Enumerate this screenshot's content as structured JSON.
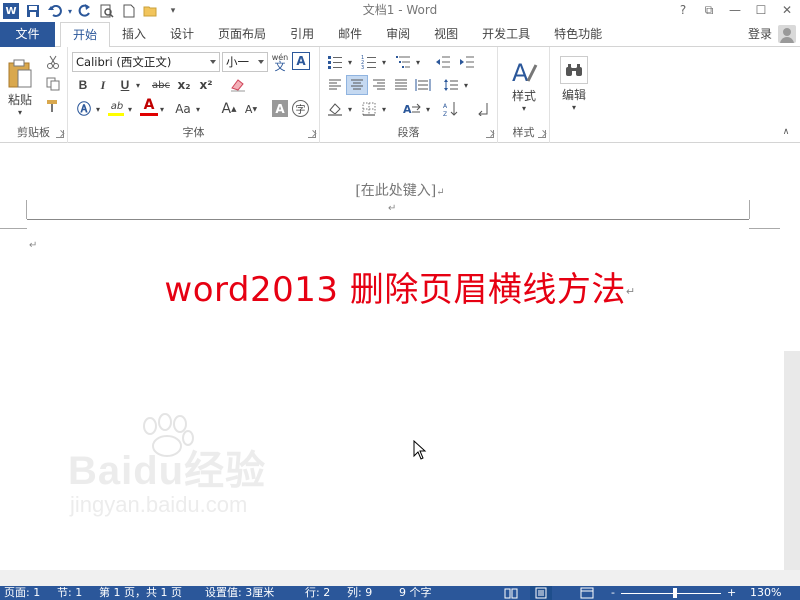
{
  "window": {
    "title": "文档1 - Word",
    "help": "?",
    "restore_ribbon": "⧉",
    "minimize": "—",
    "maximize": "☐",
    "close": "✕"
  },
  "quick_access": [
    "word-logo",
    "save-icon",
    "undo-icon",
    "redo-icon",
    "print-preview-icon",
    "new-doc-icon",
    "open-icon",
    "customize-icon"
  ],
  "tabs": {
    "file": "文件",
    "items": [
      "开始",
      "插入",
      "设计",
      "页面布局",
      "引用",
      "邮件",
      "审阅",
      "视图",
      "开发工具",
      "特色功能"
    ],
    "active": "开始",
    "login": "登录"
  },
  "ribbon": {
    "clipboard": {
      "label": "剪贴板",
      "paste": "粘贴"
    },
    "font": {
      "label": "字体",
      "font_name": "Calibri (西文正文)",
      "font_size": "小一",
      "pinyin": "wén",
      "pinyin_char": "文",
      "bold": "B",
      "italic": "I",
      "underline": "U",
      "strike": "abc",
      "subscript": "x₂",
      "superscript": "x²",
      "grow": "A",
      "shrink": "A",
      "change_case": "Aa",
      "char_shade": "A",
      "enclose": "字",
      "highlight_color": "#ffff00",
      "font_color": "#e00000"
    },
    "paragraph": {
      "label": "段落"
    },
    "styles": {
      "label": "样式",
      "button": "样式"
    },
    "editing": {
      "button": "编辑"
    }
  },
  "document": {
    "header_placeholder": "[在此处键入]",
    "body_title": "word2013 删除页眉横线方法",
    "paragraph_mark": "↵",
    "title_color": "#e60012"
  },
  "watermark": {
    "brand": "Baidu经验",
    "url": "jingyan.baidu.com"
  },
  "status": {
    "page": "页面: 1",
    "section": "节: 1",
    "page_of": "第 1 页，共 1 页",
    "setting": "设置值: 3厘米",
    "line": "行: 2",
    "column": "列: 9",
    "chars": "9 个字",
    "zoom_minus": "-",
    "zoom_plus": "+",
    "zoom": "130%"
  }
}
